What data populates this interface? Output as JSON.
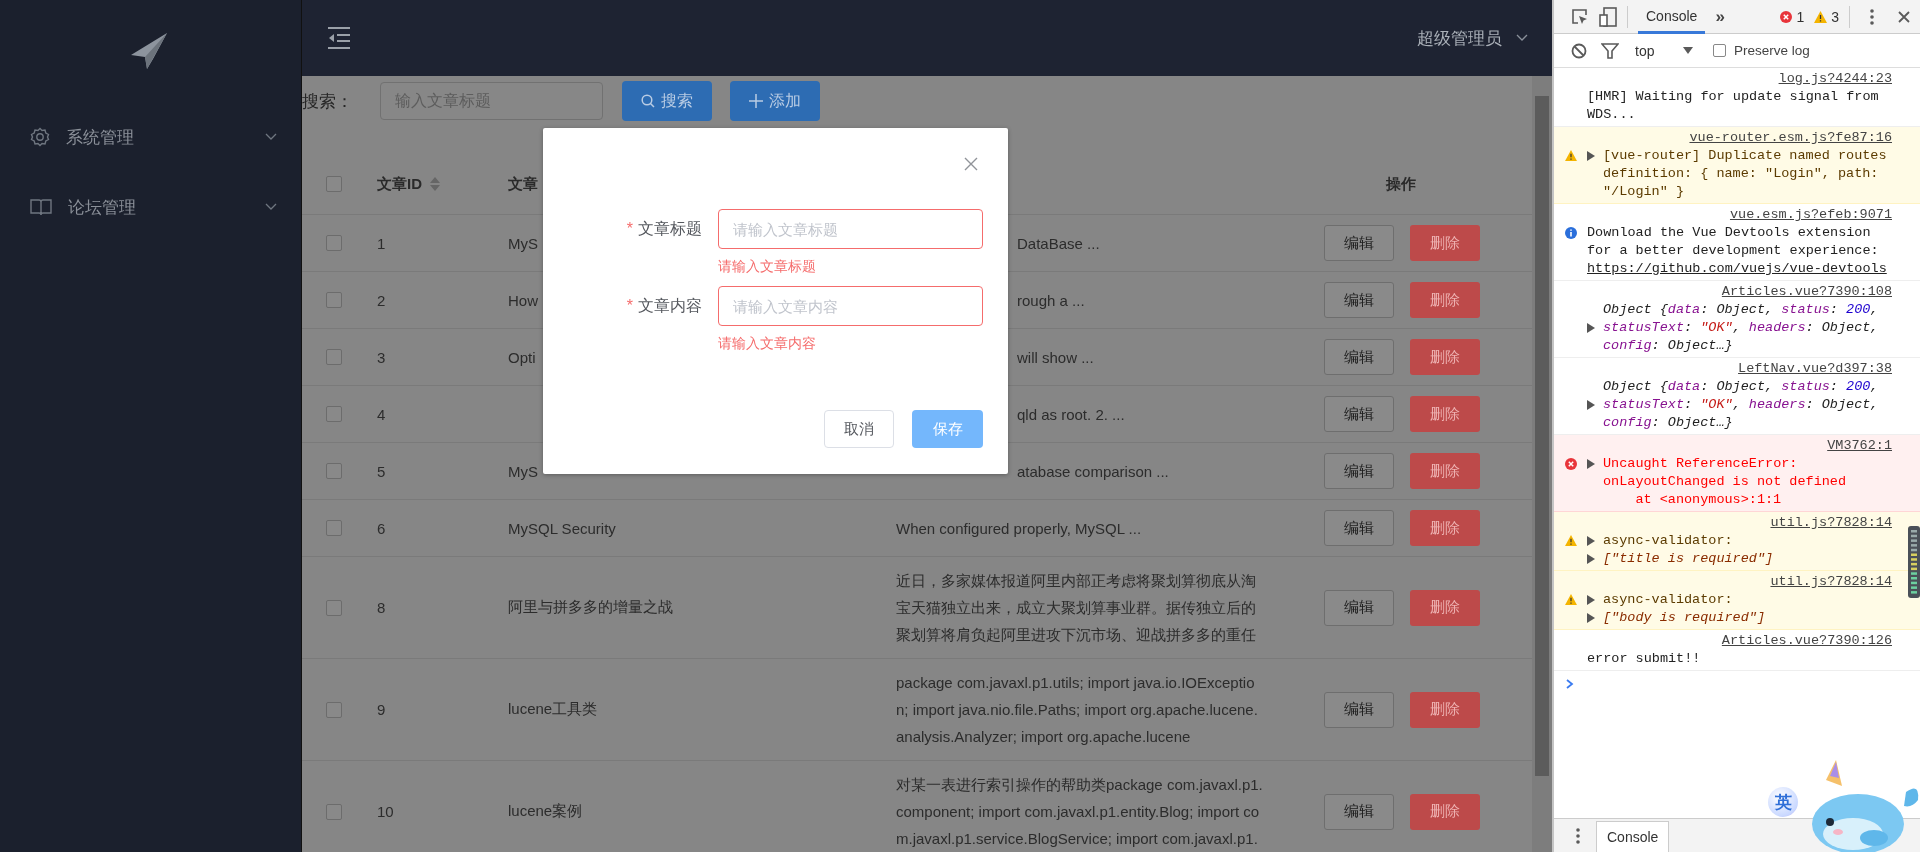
{
  "sidebar": {
    "menu": [
      {
        "label": "系统管理",
        "expanded": false
      },
      {
        "label": "论坛管理",
        "expanded": false
      }
    ]
  },
  "header": {
    "user": "超级管理员"
  },
  "toolbar": {
    "search_label": "搜索：",
    "search_placeholder": "输入文章标题",
    "buttons": [
      {
        "label": "搜索"
      },
      {
        "label": "添加"
      }
    ]
  },
  "table": {
    "all_checked": false,
    "columns": {
      "id": {
        "label": "文章ID",
        "sortable": true
      },
      "title": {
        "label": "文章"
      },
      "actions": {
        "label": "操作"
      }
    },
    "rows": [
      {
        "checked": false,
        "id": "1",
        "title": "MyS",
        "content": "DataBase ...",
        "behind_dialog": true,
        "buttons": [
          {
            "label": "编辑",
            "kind": "edit"
          },
          {
            "label": "删除",
            "kind": "delete"
          }
        ]
      },
      {
        "checked": false,
        "id": "2",
        "title": "How",
        "content": "rough a ...",
        "behind_dialog": true,
        "buttons": [
          {
            "label": "编辑",
            "kind": "edit"
          },
          {
            "label": "删除",
            "kind": "delete"
          }
        ]
      },
      {
        "checked": false,
        "id": "3",
        "title": "Opti",
        "content": "will show ...",
        "behind_dialog": true,
        "buttons": [
          {
            "label": "编辑",
            "kind": "edit"
          },
          {
            "label": "删除",
            "kind": "delete"
          }
        ]
      },
      {
        "checked": false,
        "id": "4",
        "content": "qld as root. 2. ...",
        "behind_dialog": true,
        "buttons": [
          {
            "label": "编辑",
            "kind": "edit"
          },
          {
            "label": "删除",
            "kind": "delete"
          }
        ]
      },
      {
        "checked": false,
        "id": "5",
        "title": "MyS",
        "content": "atabase comparison ...",
        "behind_dialog": true,
        "buttons": [
          {
            "label": "编辑",
            "kind": "edit"
          },
          {
            "label": "删除",
            "kind": "delete"
          }
        ]
      },
      {
        "checked": false,
        "id": "6",
        "title": "MySQL Security",
        "content": "When configured properly, MySQL ...",
        "behind_dialog": false,
        "buttons": [
          {
            "label": "编辑",
            "kind": "edit"
          },
          {
            "label": "删除",
            "kind": "delete"
          }
        ]
      },
      {
        "checked": false,
        "id": "8",
        "title": "阿里与拼多多的增量之战",
        "content": "近日，多家媒体报道阿里内部正考虑将聚划算彻底从淘宝天猫独立出来，成立大聚划算事业群。据传独立后的聚划算将肩负起阿里进攻下沉市场、迎战拼多多的重任",
        "behind_dialog": false,
        "buttons": [
          {
            "label": "编辑",
            "kind": "edit"
          },
          {
            "label": "删除",
            "kind": "delete"
          }
        ]
      },
      {
        "checked": false,
        "id": "9",
        "title": "lucene工具类",
        "content": "package com.javaxl.p1.utils; import java.io.IOException; import java.nio.file.Paths; import org.apache.lucene.analysis.Analyzer; import org.apache.lucene",
        "behind_dialog": false,
        "buttons": [
          {
            "label": "编辑",
            "kind": "edit"
          },
          {
            "label": "删除",
            "kind": "delete"
          }
        ]
      },
      {
        "checked": false,
        "id": "10",
        "title": "lucene案例",
        "content": "对某一表进行索引操作的帮助类package com.javaxl.p1.component; import com.javaxl.p1.entity.Blog; import com.javaxl.p1.service.BlogService; import com.javaxl.p1.",
        "behind_dialog": false,
        "buttons": [
          {
            "label": "编辑",
            "kind": "edit"
          },
          {
            "label": "删除",
            "kind": "delete"
          }
        ]
      }
    ]
  },
  "dialog": {
    "fields": [
      {
        "label": "文章标题",
        "required_mark": "*",
        "placeholder": "请输入文章标题",
        "error": "请输入文章标题"
      },
      {
        "label": "文章内容",
        "required_mark": "*",
        "placeholder": "请输入文章内容",
        "error": "请输入文章内容"
      }
    ],
    "buttons": [
      {
        "label": "取消",
        "kind": "default"
      },
      {
        "label": "保存",
        "kind": "primary"
      }
    ]
  },
  "devtools": {
    "tabs": [
      {
        "label": "Console",
        "selected": true
      }
    ],
    "overflow": "»",
    "error_count": "1",
    "warning_count": "3",
    "context": "top",
    "preserve_log": {
      "label": "Preserve log",
      "checked": false
    },
    "messages": [
      {
        "kind": "log",
        "source": "log.js?4244:23",
        "parts": [
          {
            "kind": "text",
            "text": "[HMR] Waiting for update signal from WDS..."
          }
        ]
      },
      {
        "kind": "warning",
        "expandable": true,
        "source": "vue-router.esm.js?fe87:16",
        "parts": [
          {
            "kind": "text",
            "text": "[vue-router] Duplicate named routes definition: { name: \"Login\", path: \"/Login\" }"
          }
        ]
      },
      {
        "kind": "info",
        "source": "vue.esm.js?efeb:9071",
        "parts": [
          {
            "kind": "text",
            "text": "Download the Vue Devtools extension for a better development experience: "
          },
          {
            "kind": "link",
            "text": "https://github.com/vuejs/vue-devtools"
          }
        ]
      },
      {
        "kind": "object",
        "expandable": true,
        "source": "Articles.vue?7390:108",
        "parts": [
          {
            "kind": "text",
            "text": "Object {"
          },
          {
            "kind": "key",
            "text": "data"
          },
          {
            "kind": "text",
            "text": ": Object, "
          },
          {
            "kind": "key",
            "text": "status"
          },
          {
            "kind": "text",
            "text": ": "
          },
          {
            "kind": "number",
            "text": "200"
          },
          {
            "kind": "text",
            "text": ", "
          },
          {
            "kind": "key",
            "text": "statusText"
          },
          {
            "kind": "text",
            "text": ": "
          },
          {
            "kind": "string",
            "text": "\"OK\""
          },
          {
            "kind": "text",
            "text": ", "
          },
          {
            "kind": "key",
            "text": "headers"
          },
          {
            "kind": "text",
            "text": ": Object, "
          },
          {
            "kind": "key",
            "text": "config"
          },
          {
            "kind": "text",
            "text": ": Object…}"
          }
        ]
      },
      {
        "kind": "object",
        "expandable": true,
        "source": "LeftNav.vue?d397:38",
        "parts": [
          {
            "kind": "text",
            "text": "Object {"
          },
          {
            "kind": "key",
            "text": "data"
          },
          {
            "kind": "text",
            "text": ": Object, "
          },
          {
            "kind": "key",
            "text": "status"
          },
          {
            "kind": "text",
            "text": ": "
          },
          {
            "kind": "number",
            "text": "200"
          },
          {
            "kind": "text",
            "text": ", "
          },
          {
            "kind": "key",
            "text": "statusText"
          },
          {
            "kind": "text",
            "text": ": "
          },
          {
            "kind": "string",
            "text": "\"OK\""
          },
          {
            "kind": "text",
            "text": ", "
          },
          {
            "kind": "key",
            "text": "headers"
          },
          {
            "kind": "text",
            "text": ": Object, "
          },
          {
            "kind": "key",
            "text": "config"
          },
          {
            "kind": "text",
            "text": ": Object…}"
          }
        ]
      },
      {
        "kind": "error",
        "expandable": true,
        "source": "VM3762:1",
        "parts": [
          {
            "kind": "text",
            "text": "Uncaught ReferenceError: onLayoutChanged is not defined"
          }
        ],
        "stack": "at <anonymous>:1:1"
      },
      {
        "kind": "warning",
        "expandable": true,
        "source": "util.js?7828:14",
        "parts": [
          {
            "kind": "text",
            "text": "async-validator:"
          }
        ],
        "detail": {
          "expandable": true,
          "text": "[\"title is required\"]"
        }
      },
      {
        "kind": "warning",
        "expandable": true,
        "source": "util.js?7828:14",
        "parts": [
          {
            "kind": "text",
            "text": "async-validator:"
          }
        ],
        "detail": {
          "expandable": true,
          "text": "[\"body is required\"]"
        }
      },
      {
        "kind": "log",
        "source": "Articles.vue?7390:126",
        "parts": [
          {
            "kind": "text",
            "text": "error submit!!"
          }
        ]
      }
    ],
    "drawer_tabs": [
      {
        "label": "Console",
        "selected": true
      }
    ]
  },
  "ime": {
    "mode": "英"
  }
}
